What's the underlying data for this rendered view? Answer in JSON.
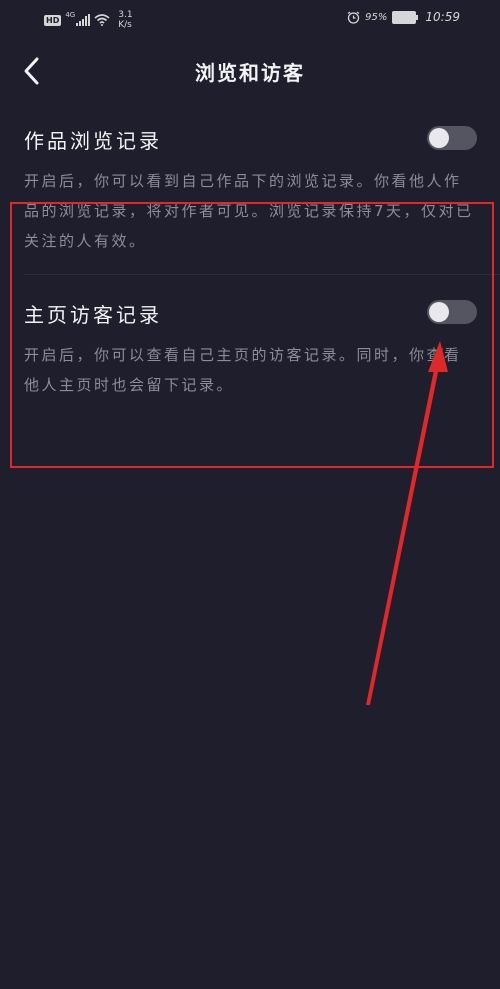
{
  "status_bar": {
    "hd": "HD",
    "network": "4G",
    "speed_value": "3.1",
    "speed_unit": "K/s",
    "battery": "95%",
    "time": "10:59",
    "icons": [
      "signal-icon",
      "wifi-icon",
      "alarm-icon",
      "battery-icon"
    ]
  },
  "header": {
    "title": "浏览和访客",
    "back_icon": "chevron-left-icon"
  },
  "settings": [
    {
      "title": "作品浏览记录",
      "description": "开启后，你可以看到自己作品下的浏览记录。你看他人作品的浏览记录，将对作者可见。浏览记录保持7天，仅对已关注的人有效。",
      "enabled": false
    },
    {
      "title": "主页访客记录",
      "description": "开启后，你可以查看自己主页的访客记录。同时，你查看他人主页时也会留下记录。",
      "enabled": false
    }
  ],
  "colors": {
    "background": "#1e1e2c",
    "text_primary": "#f3f3f3",
    "text_secondary": "#8d8c98",
    "toggle_off": "#555561",
    "annotation": "#e02828"
  }
}
